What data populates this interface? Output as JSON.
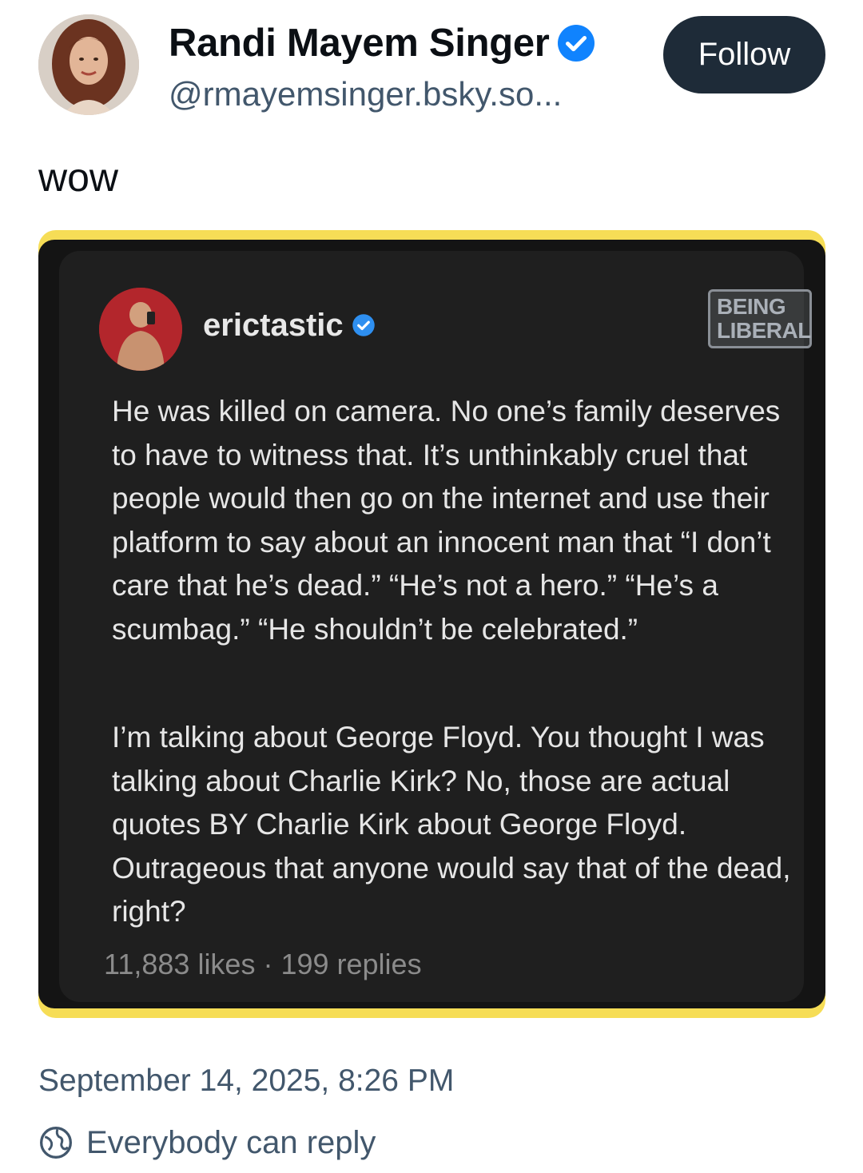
{
  "author": {
    "display_name": "Randi Mayem Singer",
    "handle": "@rmayemsinger.bsky.so...",
    "verified": true,
    "avatar_icon": "profile-photo"
  },
  "actions": {
    "follow_label": "Follow"
  },
  "post": {
    "text": "wow",
    "timestamp": "September 14, 2025, 8:26 PM",
    "reply_setting": "Everybody can reply"
  },
  "embed": {
    "username": "erictastic",
    "verified": true,
    "watermark_line1": "BEING",
    "watermark_line2": "LIBERAL",
    "paragraph1": "He was killed on camera. No one’s family deserves to have to witness that. It’s unthinkably cruel that people would then go on the internet and use their platform to say about an innocent man that “I don’t care that he’s dead.” “He’s not a hero.” “He’s a scumbag.” “He shouldn’t be celebrated.”",
    "paragraph2": "I’m talking about George Floyd. You thought I was talking about Charlie Kirk? No, those are actual quotes BY Charlie Kirk about George Floyd. Outrageous that anyone would say that of the dead, right?",
    "stats": "11,883 likes · 199 replies"
  },
  "colors": {
    "text_primary": "#0b0f14",
    "text_secondary": "#42576c",
    "follow_bg": "#1e2b38",
    "verified_blue": "#1083fe",
    "embed_border_yellow": "#f6dd56",
    "embed_bg": "#1f1f1f"
  }
}
